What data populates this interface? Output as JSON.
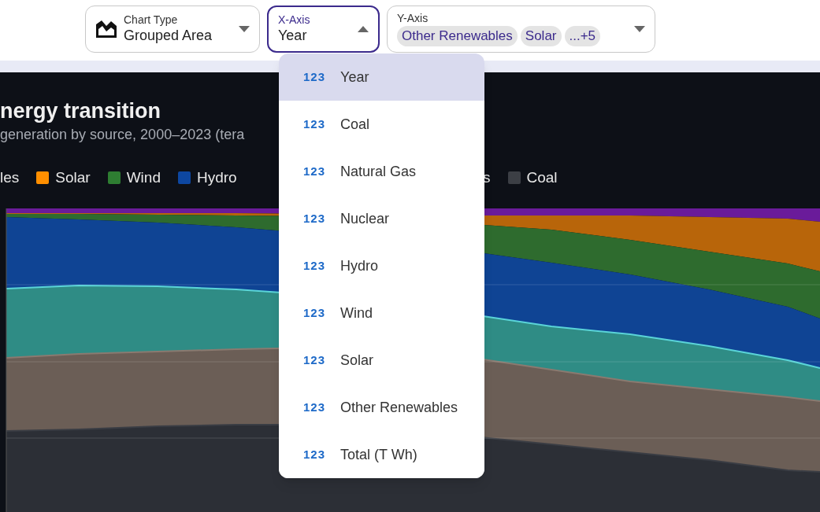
{
  "controls": [
    {
      "kind": "chart_type",
      "label": "Chart Type",
      "value": "Grouped Area",
      "open": false
    },
    {
      "kind": "x_axis",
      "label": "X-Axis",
      "value": "Year",
      "open": true
    },
    {
      "kind": "y_axis",
      "label": "Y-Axis",
      "chips": [
        "Other Renewables",
        "Solar",
        "...+5"
      ],
      "open": false
    }
  ],
  "chart": {
    "title": "nergy transition",
    "subtitle": "generation by source, 2000–2023 (tera",
    "legend": [
      {
        "label": "les"
      },
      {
        "label": "Solar",
        "color": "#ff8f00"
      },
      {
        "label": "Wind",
        "color": "#2e7d32"
      },
      {
        "label": "Hydro",
        "color": "#0d47a1"
      },
      {
        "label": "s"
      },
      {
        "label": "Coal",
        "color": "#3c3f45"
      }
    ]
  },
  "dropdown": {
    "items": [
      {
        "type_label": "123",
        "label": "Year",
        "selected": true
      },
      {
        "type_label": "123",
        "label": "Coal",
        "selected": false
      },
      {
        "type_label": "123",
        "label": "Natural Gas",
        "selected": false
      },
      {
        "type_label": "123",
        "label": "Nuclear",
        "selected": false
      },
      {
        "type_label": "123",
        "label": "Hydro",
        "selected": false
      },
      {
        "type_label": "123",
        "label": "Wind",
        "selected": false
      },
      {
        "type_label": "123",
        "label": "Solar",
        "selected": false
      },
      {
        "type_label": "123",
        "label": "Other Renewables",
        "selected": false
      },
      {
        "type_label": "123",
        "label": "Total (T Wh)",
        "selected": false
      }
    ]
  }
}
